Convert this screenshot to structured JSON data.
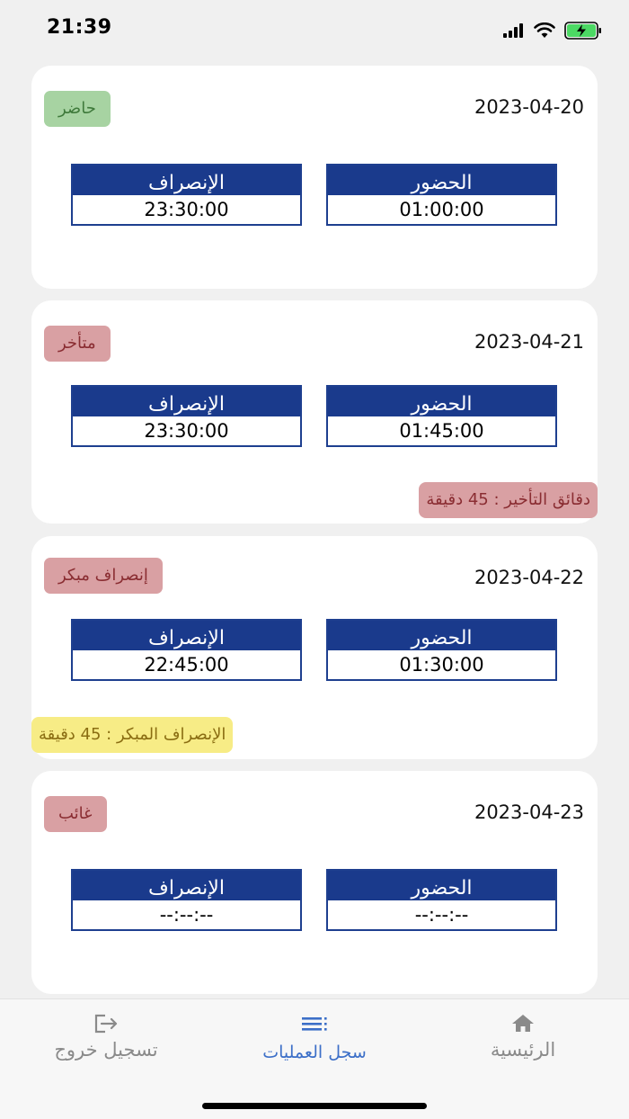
{
  "status": {
    "time": "21:39"
  },
  "records": [
    {
      "date": "2023-04-20",
      "status": "حاضر",
      "status_color": "#a7d3a2",
      "leave_label": "الإنصراف",
      "leave_time": "23:30:00",
      "arrive_label": "الحضور",
      "arrive_time": "01:00:00"
    },
    {
      "date": "2023-04-21",
      "status": "متأخر",
      "status_color": "#d9a0a3",
      "leave_label": "الإنصراف",
      "leave_time": "23:30:00",
      "arrive_label": "الحضور",
      "arrive_time": "01:45:00",
      "note": "دقائق التأخير : 45 دقيقة"
    },
    {
      "date": "2023-04-22",
      "status": "إنصراف مبكر",
      "status_color": "#d9a0a3",
      "leave_label": "الإنصراف",
      "leave_time": "22:45:00",
      "arrive_label": "الحضور",
      "arrive_time": "01:30:00",
      "note": "الإنصراف المبكر : 45 دقيقة"
    },
    {
      "date": "2023-04-23",
      "status": "غائب",
      "status_color": "#d9a0a3",
      "leave_label": "الإنصراف",
      "leave_time": "--:--:--",
      "arrive_label": "الحضور",
      "arrive_time": "--:--:--"
    }
  ],
  "tabbar": {
    "logout": {
      "label": "تسجيل خروج",
      "icon": "logout-icon"
    },
    "history": {
      "label": "سجل العمليات",
      "icon": "list-icon"
    },
    "home": {
      "label": "الرئيسية",
      "icon": "home-icon"
    }
  },
  "colors": {
    "header_blue": "#1a3a8c",
    "accent": "#3c6fc8"
  }
}
